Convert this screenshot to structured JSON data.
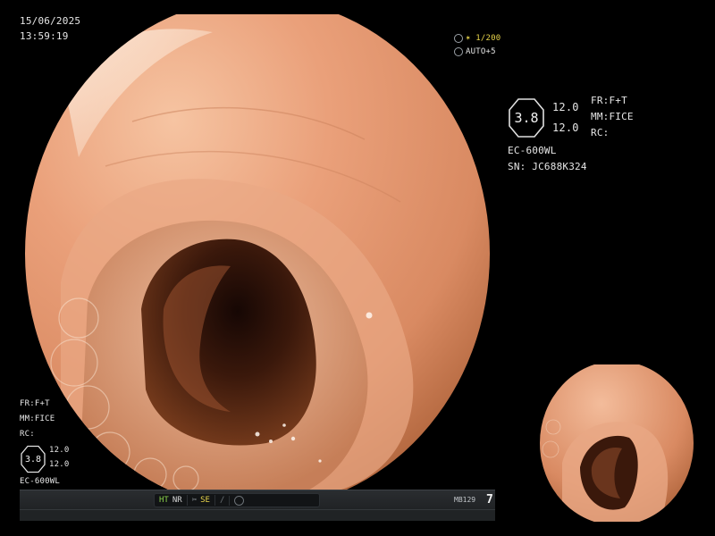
{
  "datetime": {
    "date": "15/06/2025",
    "time": "13:59:19"
  },
  "top_right": {
    "shutter": "✶ 1/200",
    "auto": "AUTO+5"
  },
  "right_panel": {
    "hex_value": "3.8",
    "value_top": "12.0",
    "value_bottom": "12.0",
    "fr": "FR:F+T",
    "mm": "MM:FICE",
    "rc": "RC:",
    "scope_model": "EC-600WL",
    "serial": "SN: JC688K324"
  },
  "left_panel": {
    "fr": "FR:F+T",
    "mm": "MM:FICE",
    "rc": "RC:",
    "hex_value": "3.8",
    "value_top": "12.0",
    "value_bottom": "12.0",
    "scope_model": "EC-600WL"
  },
  "status_bar": {
    "ht": "HT",
    "nr": "NR",
    "se": "SE",
    "code": "MB129",
    "number": "7"
  },
  "colors": {
    "mucosa_light": "#f0b08e",
    "mucosa_mid": "#d9875f",
    "mucosa_dark": "#8a4a2a",
    "lumen": "#2a120a",
    "accent_green": "#8ad04a",
    "accent_yellow": "#e8d44a"
  },
  "icons": {
    "shutter": "camera-aperture-icon",
    "auto": "auto-exposure-icon",
    "se": "scissors-icon",
    "pen": "pen-icon",
    "circle": "circle-mode-icon"
  }
}
